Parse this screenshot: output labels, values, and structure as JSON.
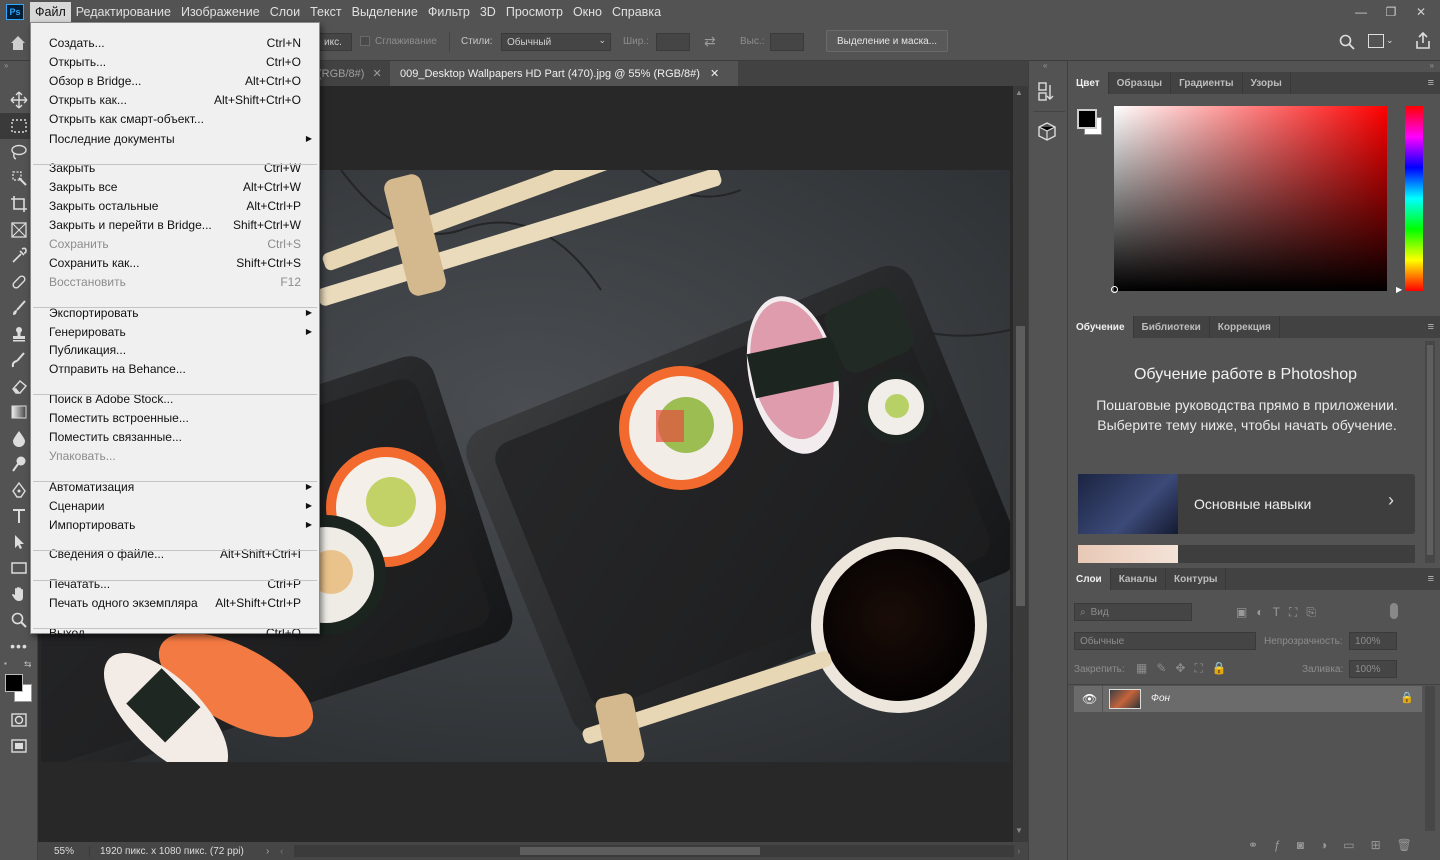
{
  "app": {
    "logo": "Ps"
  },
  "menubar": {
    "items": [
      "Файл",
      "Редактирование",
      "Изображение",
      "Слои",
      "Текст",
      "Выделение",
      "Фильтр",
      "3D",
      "Просмотр",
      "Окно",
      "Справка"
    ]
  },
  "window_controls": {
    "minimize": "—",
    "restore": "❐",
    "close": "✕"
  },
  "options_bar": {
    "feather_tail": "икс.",
    "antialias_label": "Сглаживание",
    "style_label": "Стили:",
    "style_value": "Обычный",
    "width_label": "Шир.:",
    "height_label": "Выс.:",
    "select_mask_button": "Выделение и маска..."
  },
  "tabs": {
    "tab1": "(RGB/8#)",
    "tab2": "009_Desktop Wallpapers  HD Part (470).jpg @ 55% (RGB/8#)"
  },
  "file_menu": {
    "items": [
      {
        "label": "Создать...",
        "shortcut": "Ctrl+N",
        "disabled": false,
        "submenu": false
      },
      {
        "label": "Открыть...",
        "shortcut": "Ctrl+O",
        "disabled": false,
        "submenu": false
      },
      {
        "label": "Обзор в Bridge...",
        "shortcut": "Alt+Ctrl+O",
        "disabled": false,
        "submenu": false
      },
      {
        "label": "Открыть как...",
        "shortcut": "Alt+Shift+Ctrl+O",
        "disabled": false,
        "submenu": false
      },
      {
        "label": "Открыть как смарт-объект...",
        "shortcut": "",
        "disabled": false,
        "submenu": false
      },
      {
        "label": "Последние документы",
        "shortcut": "",
        "disabled": false,
        "submenu": true
      },
      {
        "label": "Закрыть",
        "shortcut": "Ctrl+W",
        "disabled": false,
        "submenu": false
      },
      {
        "label": "Закрыть все",
        "shortcut": "Alt+Ctrl+W",
        "disabled": false,
        "submenu": false
      },
      {
        "label": "Закрыть остальные",
        "shortcut": "Alt+Ctrl+P",
        "disabled": false,
        "submenu": false
      },
      {
        "label": "Закрыть и перейти в Bridge...",
        "shortcut": "Shift+Ctrl+W",
        "disabled": false,
        "submenu": false
      },
      {
        "label": "Сохранить",
        "shortcut": "Ctrl+S",
        "disabled": true,
        "submenu": false
      },
      {
        "label": "Сохранить как...",
        "shortcut": "Shift+Ctrl+S",
        "disabled": false,
        "submenu": false
      },
      {
        "label": "Восстановить",
        "shortcut": "F12",
        "disabled": true,
        "submenu": false
      },
      {
        "label": "Экспортировать",
        "shortcut": "",
        "disabled": false,
        "submenu": true
      },
      {
        "label": "Генерировать",
        "shortcut": "",
        "disabled": false,
        "submenu": true
      },
      {
        "label": "Публикация...",
        "shortcut": "",
        "disabled": false,
        "submenu": false
      },
      {
        "label": "Отправить на Behance...",
        "shortcut": "",
        "disabled": false,
        "submenu": false
      },
      {
        "label": "Поиск в Adobe Stock...",
        "shortcut": "",
        "disabled": false,
        "submenu": false
      },
      {
        "label": "Поместить встроенные...",
        "shortcut": "",
        "disabled": false,
        "submenu": false
      },
      {
        "label": "Поместить связанные...",
        "shortcut": "",
        "disabled": false,
        "submenu": false
      },
      {
        "label": "Упаковать...",
        "shortcut": "",
        "disabled": true,
        "submenu": false
      },
      {
        "label": "Автоматизация",
        "shortcut": "",
        "disabled": false,
        "submenu": true
      },
      {
        "label": "Сценарии",
        "shortcut": "",
        "disabled": false,
        "submenu": true
      },
      {
        "label": "Импортировать",
        "shortcut": "",
        "disabled": false,
        "submenu": true
      },
      {
        "label": "Сведения о файле...",
        "shortcut": "Alt+Shift+Ctrl+I",
        "disabled": false,
        "submenu": false
      },
      {
        "label": "Печатать...",
        "shortcut": "Ctrl+P",
        "disabled": false,
        "submenu": false
      },
      {
        "label": "Печать одного экземпляра",
        "shortcut": "Alt+Shift+Ctrl+P",
        "disabled": false,
        "submenu": false
      },
      {
        "label": "Выход",
        "shortcut": "Ctrl+Q",
        "disabled": false,
        "submenu": false
      }
    ]
  },
  "color_panel": {
    "tabs": [
      "Цвет",
      "Образцы",
      "Градиенты",
      "Узоры"
    ],
    "hue_color": "#ff0000",
    "foreground": "#000000",
    "background": "#ffffff"
  },
  "learn_panel": {
    "tabs": [
      "Обучение",
      "Библиотеки",
      "Коррекция"
    ],
    "title": "Обучение работе в Photoshop",
    "description": "Пошаговые руководства прямо в приложении. Выберите тему ниже, чтобы начать обучение.",
    "card_label": "Основные навыки"
  },
  "layers_panel": {
    "tabs": [
      "Слои",
      "Каналы",
      "Контуры"
    ],
    "filter_placeholder": "Вид",
    "blend_mode": "Обычные",
    "opacity_label": "Непрозрачность:",
    "opacity_value": "100%",
    "lock_label": "Закрепить:",
    "fill_label": "Заливка:",
    "fill_value": "100%",
    "layer_name": "Фон"
  },
  "status": {
    "zoom": "55%",
    "doc_info": "1920 пикс. x 1080 пикс. (72 ppi)"
  }
}
